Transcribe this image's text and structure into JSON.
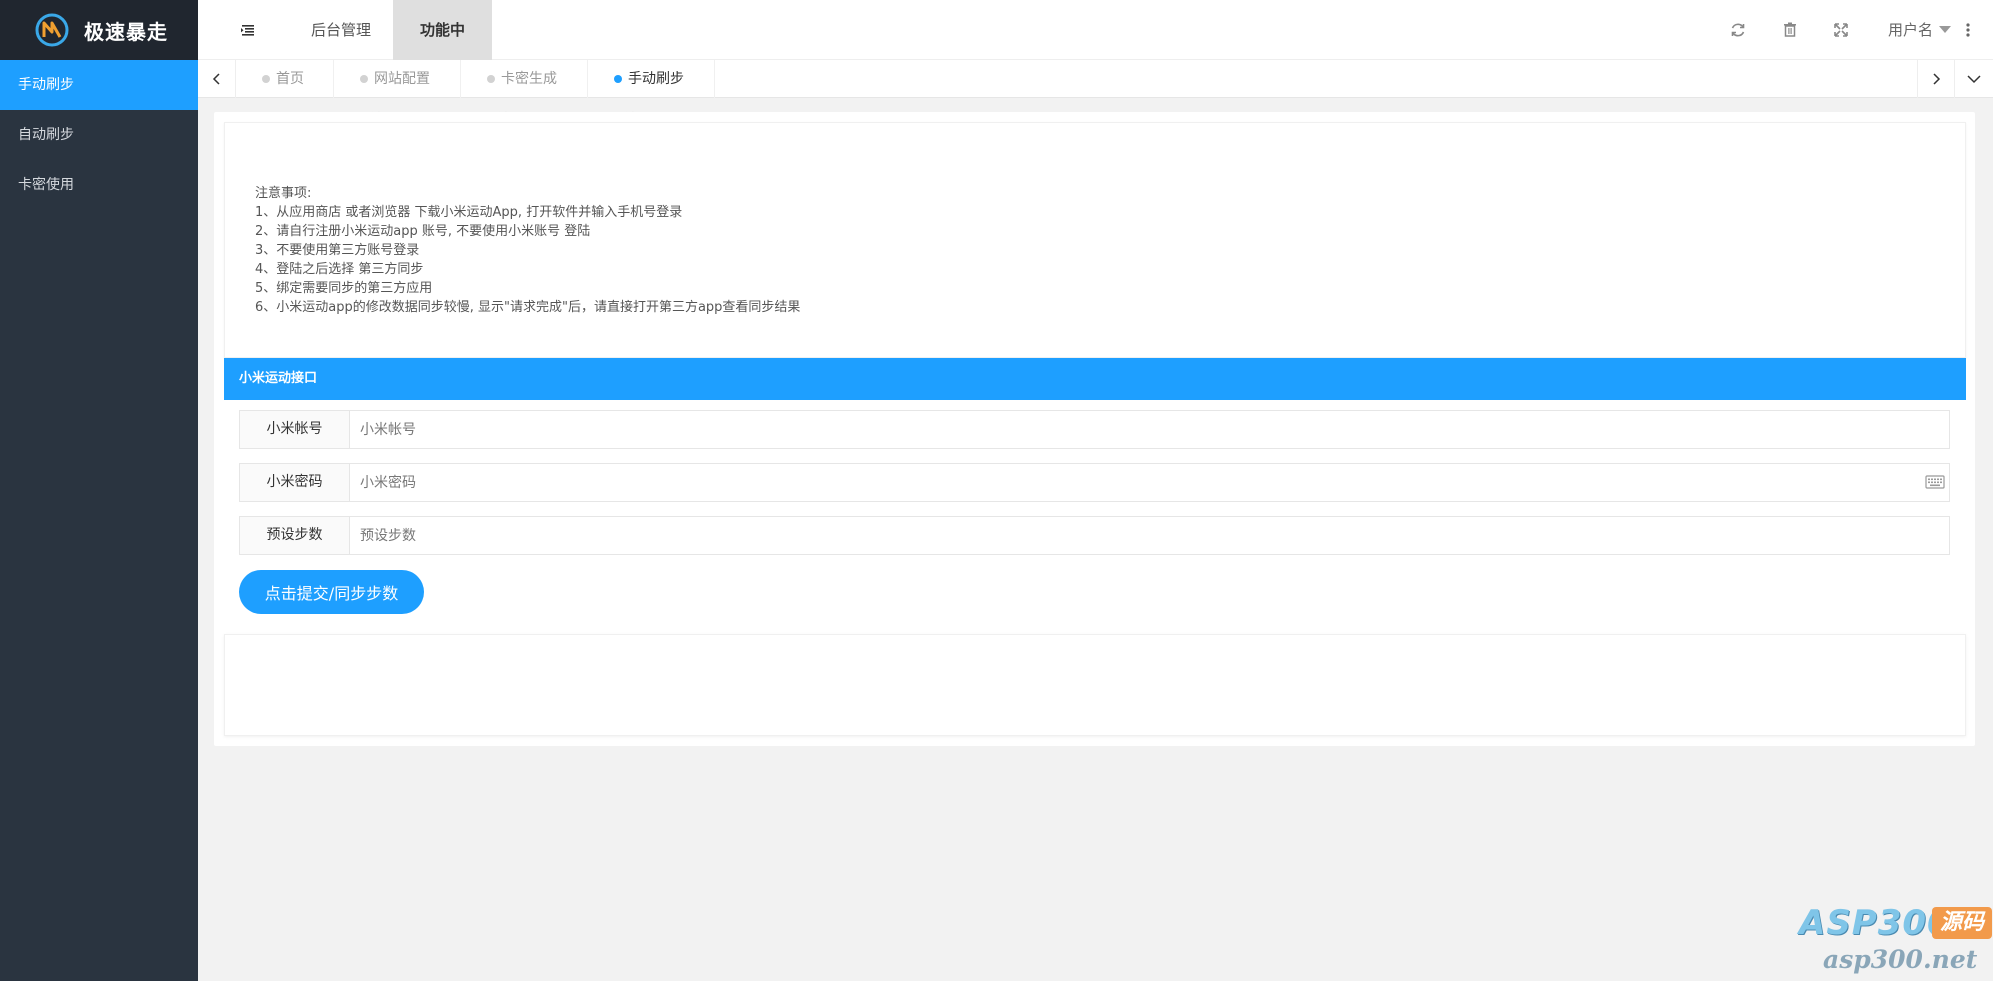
{
  "brand": {
    "name": "极速暴走"
  },
  "sidebar": {
    "items": [
      {
        "label": "手动刷步",
        "active": true
      },
      {
        "label": "自动刷步",
        "active": false
      },
      {
        "label": "卡密使用",
        "active": false
      }
    ]
  },
  "header": {
    "tabs": [
      {
        "label": "后台管理"
      },
      {
        "label": "功能中心"
      }
    ],
    "user": "用户名",
    "icons": [
      "refresh-icon",
      "trash-icon",
      "fullscreen-icon",
      "more-icon"
    ]
  },
  "page_tabs": [
    {
      "label": "首页",
      "closable": false,
      "active": false
    },
    {
      "label": "网站配置",
      "closable": true,
      "active": false
    },
    {
      "label": "卡密生成",
      "closable": true,
      "active": false
    },
    {
      "label": "手动刷步",
      "closable": true,
      "active": true
    }
  ],
  "notice": {
    "title": "注意事项:",
    "lines": [
      "1、从应用商店 或者浏览器 下载小米运动App, 打开软件并输入手机号登录",
      "2、请自行注册小米运动app 账号, 不要使用小米账号 登陆",
      "3、不要使用第三方账号登录",
      "4、登陆之后选择 第三方同步",
      "5、绑定需要同步的第三方应用",
      "6、小米运动app的修改数据同步较慢, 显示\"请求完成\"后，请直接打开第三方app查看同步结果"
    ]
  },
  "panel": {
    "title": "小米运动接口",
    "fields": [
      {
        "label": "小米帐号",
        "placeholder": "小米帐号",
        "value": ""
      },
      {
        "label": "小米密码",
        "placeholder": "小米密码",
        "value": ""
      },
      {
        "label": "预设步数",
        "placeholder": "预设步数",
        "value": ""
      }
    ],
    "submit_label": "点击提交/同步步数"
  },
  "watermark": {
    "top": "ASP300",
    "badge": "源码",
    "bottom": "asp300.net"
  },
  "colors": {
    "accent": "#1e9fff",
    "sidebar_bg": "#2a3440",
    "logo_bg": "#20262f"
  }
}
